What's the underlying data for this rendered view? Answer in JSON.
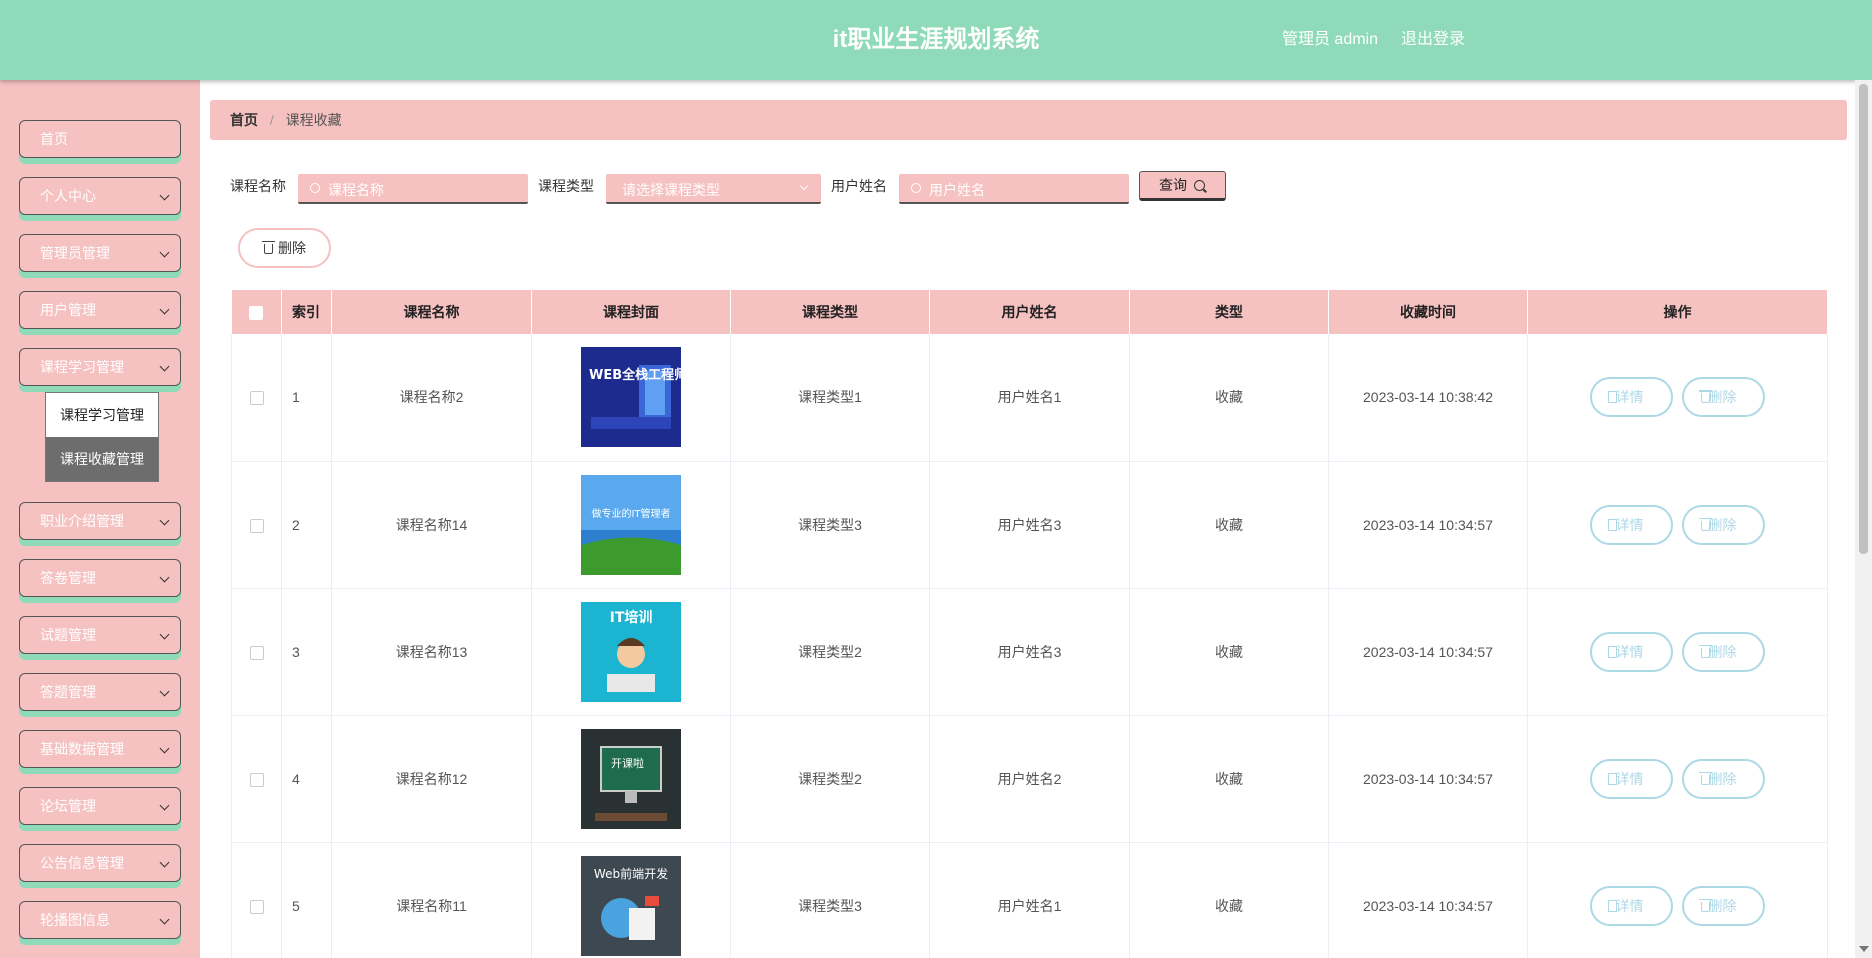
{
  "header": {
    "title": "it职业生涯规划系统",
    "user": "管理员 admin",
    "logout": "退出登录"
  },
  "sidebar": {
    "items": [
      {
        "label": "首页",
        "expandable": false
      },
      {
        "label": "个人中心",
        "expandable": true
      },
      {
        "label": "管理员管理",
        "expandable": true
      },
      {
        "label": "用户管理",
        "expandable": true
      },
      {
        "label": "课程学习管理",
        "expandable": true
      },
      {
        "label": "职业介绍管理",
        "expandable": true
      },
      {
        "label": "答卷管理",
        "expandable": true
      },
      {
        "label": "试题管理",
        "expandable": true
      },
      {
        "label": "答题管理",
        "expandable": true
      },
      {
        "label": "基础数据管理",
        "expandable": true
      },
      {
        "label": "论坛管理",
        "expandable": true
      },
      {
        "label": "公告信息管理",
        "expandable": true
      },
      {
        "label": "轮播图信息",
        "expandable": true
      }
    ],
    "submenu": [
      "课程学习管理",
      "课程收藏管理"
    ]
  },
  "breadcrumb": {
    "home": "首页",
    "separator": "/",
    "current": "课程收藏"
  },
  "search": {
    "course_name_label": "课程名称",
    "course_name_placeholder": "课程名称",
    "course_type_label": "课程类型",
    "course_type_placeholder": "请选择课程类型",
    "user_name_label": "用户姓名",
    "user_name_placeholder": "用户姓名",
    "query_label": "查询"
  },
  "toolbar": {
    "delete_label": "删除"
  },
  "table": {
    "headers": [
      "索引",
      "课程名称",
      "课程封面",
      "课程类型",
      "用户姓名",
      "类型",
      "收藏时间",
      "操作"
    ],
    "rows": [
      {
        "index": "1",
        "name": "课程名称2",
        "cover_text": "WEB全栈工程师",
        "type": "课程类型1",
        "user": "用户姓名1",
        "kind": "收藏",
        "time": "2023-03-14 10:38:42"
      },
      {
        "index": "2",
        "name": "课程名称14",
        "cover_text": "做专业的IT管理者",
        "type": "课程类型3",
        "user": "用户姓名3",
        "kind": "收藏",
        "time": "2023-03-14 10:34:57"
      },
      {
        "index": "3",
        "name": "课程名称13",
        "cover_text": "IT培训",
        "type": "课程类型2",
        "user": "用户姓名3",
        "kind": "收藏",
        "time": "2023-03-14 10:34:57"
      },
      {
        "index": "4",
        "name": "课程名称12",
        "cover_text": "开课啦",
        "type": "课程类型2",
        "user": "用户姓名2",
        "kind": "收藏",
        "time": "2023-03-14 10:34:57"
      },
      {
        "index": "5",
        "name": "课程名称11",
        "cover_text": "Web前端开发",
        "type": "课程类型3",
        "user": "用户姓名1",
        "kind": "收藏",
        "time": "2023-03-14 10:34:57"
      }
    ],
    "detail_label": "详情",
    "delete_label": "删除"
  },
  "colors": {
    "header": "#8fdab9",
    "pink": "#f6c1c1",
    "op_button": "#add8e6"
  }
}
